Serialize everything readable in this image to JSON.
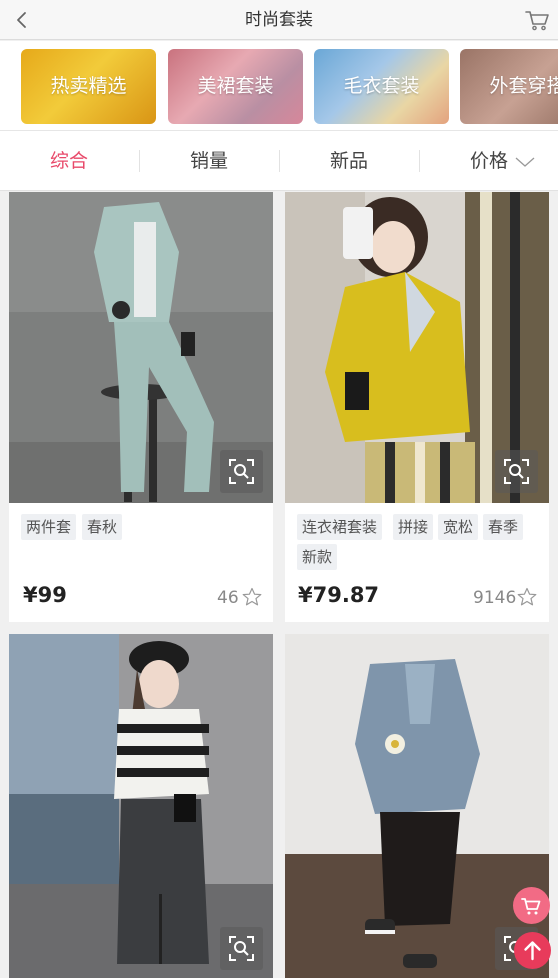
{
  "header": {
    "title": "时尚套装"
  },
  "categories": [
    "热卖精选",
    "美裙套装",
    "毛衣套装",
    "外套穿搭"
  ],
  "sort": {
    "items": [
      "综合",
      "销量",
      "新品",
      "价格"
    ],
    "active": "综合"
  },
  "products": [
    {
      "tags": [
        "两件套",
        "春秋"
      ],
      "price": "¥99",
      "favorites": "46"
    },
    {
      "tags": [
        "连衣裙套装",
        "拼接",
        "宽松",
        "春季",
        "新款"
      ],
      "price": "¥79.87",
      "favorites": "9146"
    },
    {
      "tags": [],
      "price": "",
      "favorites": ""
    },
    {
      "tags": [],
      "price": "",
      "favorites": ""
    }
  ],
  "colors": {
    "accent": "#e84a6a",
    "fab_cart": "#f26b85",
    "fab_top": "#e83b5b"
  },
  "icons": [
    "back-icon",
    "cart-icon",
    "chevron-down-icon",
    "zoom-icon",
    "star-icon",
    "cart-fab-icon",
    "arrow-up-icon"
  ]
}
